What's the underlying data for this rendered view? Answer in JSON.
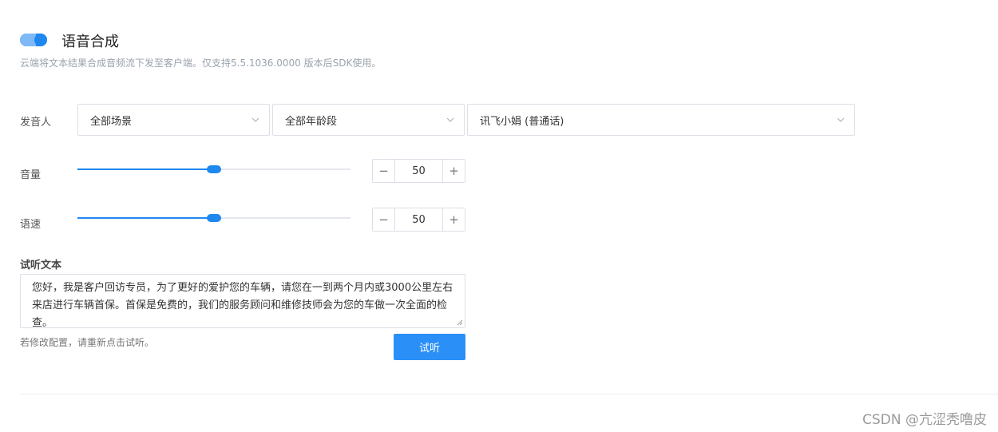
{
  "header": {
    "title": "语音合成",
    "description": "云端将文本结果合成音频流下发至客户端。仅支持5.5.1036.0000 版本后SDK使用。",
    "toggle_on": true
  },
  "speaker": {
    "label": "发音人",
    "scene": "全部场景",
    "age": "全部年龄段",
    "voice": "讯飞小娟 (普通话)"
  },
  "volume": {
    "label": "音量",
    "value": "50",
    "level": 50,
    "minus": "−",
    "plus": "+"
  },
  "speed": {
    "label": "语速",
    "value": "50",
    "level": 50,
    "minus": "−",
    "plus": "+"
  },
  "preview": {
    "label": "试听文本",
    "text": "您好，我是客户回访专员，为了更好的爱护您的车辆，请您在一到两个月内或3000公里左右来店进行车辆首保。首保是免费的，我们的服务顾问和维修技师会为您的车做一次全面的检查。",
    "hint": "若修改配置，请重新点击试听。",
    "button": "试听"
  },
  "watermark": "CSDN @亢涩秃噜皮",
  "colors": {
    "accent": "#1e88f0",
    "button": "#2a8ff7",
    "border": "#dcdfe6"
  }
}
